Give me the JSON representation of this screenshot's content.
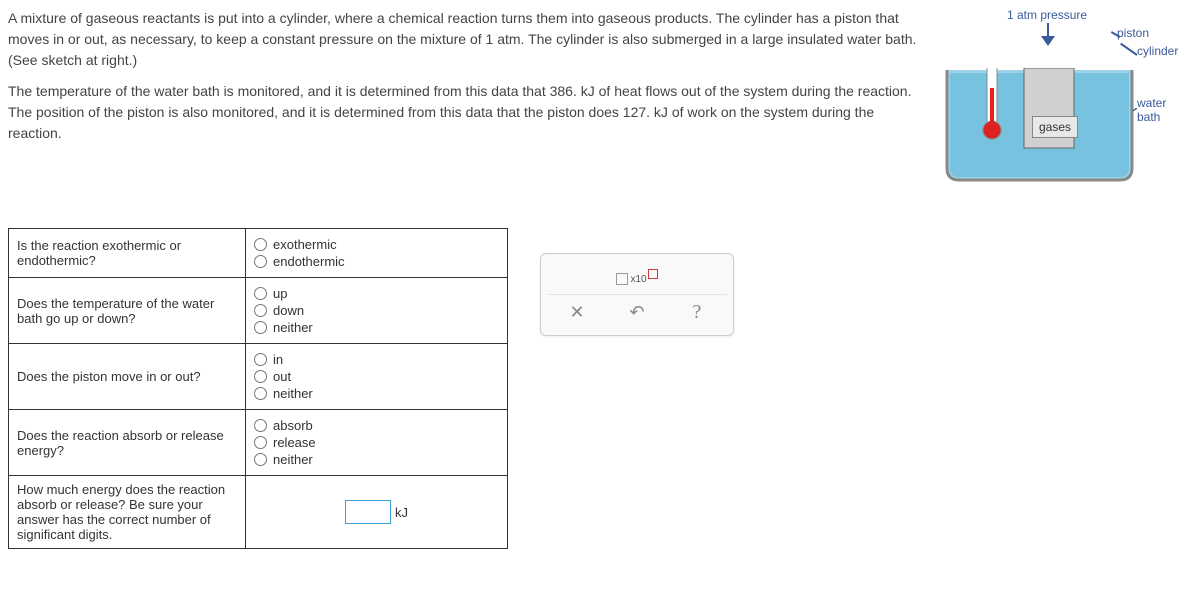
{
  "description": {
    "p1": "A mixture of gaseous reactants is put into a cylinder, where a chemical reaction turns them into gaseous products. The cylinder has a piston that moves in or out, as necessary, to keep a constant pressure on the mixture of 1 atm. The cylinder is also submerged in a large insulated water bath. (See sketch at right.)",
    "p2": "The temperature of the water bath is monitored, and it is determined from this data that 386. kJ of heat flows out of the system during the reaction. The position of the piston is also monitored, and it is determined from this data that the piston does 127. kJ of work on the system during the reaction."
  },
  "diagram": {
    "pressure": "1 atm pressure",
    "piston": "piston",
    "cylinder": "cylinder",
    "waterbath": "water bath",
    "gases": "gases"
  },
  "questions": {
    "q1": {
      "text": "Is the reaction exothermic or endothermic?",
      "opts": [
        "exothermic",
        "endothermic"
      ]
    },
    "q2": {
      "text": "Does the temperature of the water bath go up or down?",
      "opts": [
        "up",
        "down",
        "neither"
      ]
    },
    "q3": {
      "text": "Does the piston move in or out?",
      "opts": [
        "in",
        "out",
        "neither"
      ]
    },
    "q4": {
      "text": "Does the reaction absorb or release energy?",
      "opts": [
        "absorb",
        "release",
        "neither"
      ]
    },
    "q5": {
      "text": "How much energy does the reaction absorb or release? Be sure your answer has the correct number of significant digits.",
      "unit": "kJ"
    }
  }
}
